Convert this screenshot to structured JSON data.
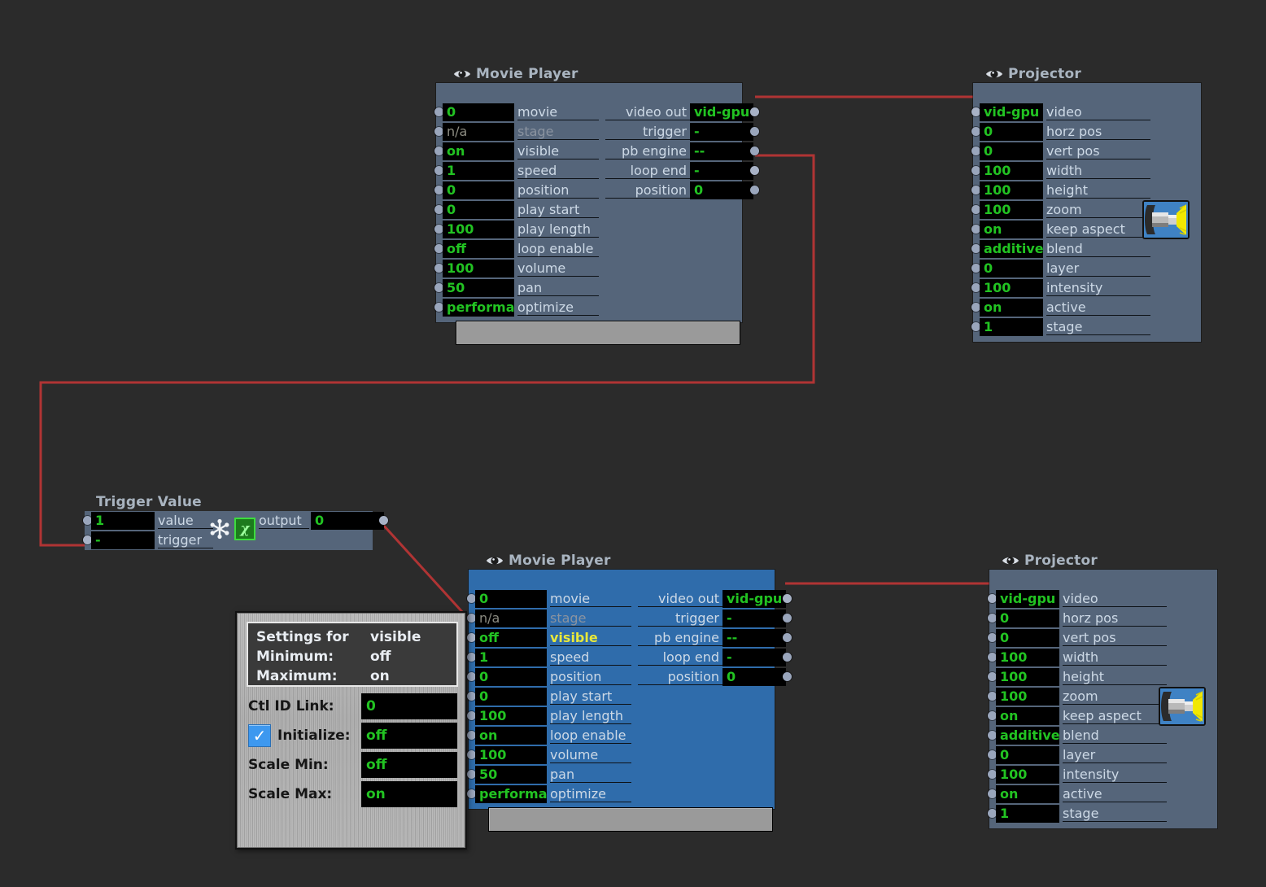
{
  "canvas": {
    "background": "#2b2b2b",
    "wire_color": "#b03434",
    "value_color": "#22c322",
    "selected_node_color": "#2f6cab"
  },
  "nodes": [
    {
      "id": "movie-player-1",
      "title": "Movie Player",
      "icon": "eye-icon",
      "selected": false,
      "inputs": [
        {
          "value": "0",
          "label": "movie"
        },
        {
          "value": "n/a",
          "label": "stage",
          "dim": true
        },
        {
          "value": "on",
          "label": "visible"
        },
        {
          "value": "1",
          "label": "speed"
        },
        {
          "value": "0",
          "label": "position"
        },
        {
          "value": "0",
          "label": "play start"
        },
        {
          "value": "100",
          "label": "play length"
        },
        {
          "value": "off",
          "label": "loop enable"
        },
        {
          "value": "100",
          "label": "volume"
        },
        {
          "value": "50",
          "label": "pan"
        },
        {
          "value": "performance",
          "label": "optimize"
        }
      ],
      "outputs": [
        {
          "label": "video out",
          "value": "vid-gpu",
          "connected": true
        },
        {
          "label": "trigger",
          "value": "-"
        },
        {
          "label": "pb engine",
          "value": "--"
        },
        {
          "label": "loop end",
          "value": "-",
          "connected": true
        },
        {
          "label": "position",
          "value": "0"
        }
      ],
      "has_scrubber": true
    },
    {
      "id": "projector-1",
      "title": "Projector",
      "icon": "eye-icon",
      "selected": false,
      "inputs": [
        {
          "value": "vid-gpu",
          "label": "video",
          "connected": true
        },
        {
          "value": "0",
          "label": "horz pos"
        },
        {
          "value": "0",
          "label": "vert pos"
        },
        {
          "value": "100",
          "label": "width"
        },
        {
          "value": "100",
          "label": "height"
        },
        {
          "value": "100",
          "label": "zoom"
        },
        {
          "value": "on",
          "label": "keep aspect"
        },
        {
          "value": "additive",
          "label": "blend"
        },
        {
          "value": "0",
          "label": "layer"
        },
        {
          "value": "100",
          "label": "intensity"
        },
        {
          "value": "on",
          "label": "active"
        },
        {
          "value": "1",
          "label": "stage"
        }
      ],
      "outputs": [],
      "lamp_icon": "projector-lamp-icon"
    },
    {
      "id": "trigger-value",
      "title": "Trigger Value",
      "icon": null,
      "selected": false,
      "inputs": [
        {
          "value": "1",
          "label": "value"
        },
        {
          "value": "-",
          "label": "trigger",
          "connected": true
        }
      ],
      "outputs": [
        {
          "label": "output",
          "value": "0",
          "connected": true
        }
      ],
      "icons": [
        "snowflake-icon",
        "curve-function-icon"
      ],
      "curve_glyph": "χ"
    },
    {
      "id": "movie-player-2",
      "title": "Movie Player",
      "icon": "eye-icon",
      "selected": true,
      "inputs": [
        {
          "value": "0",
          "label": "movie"
        },
        {
          "value": "n/a",
          "label": "stage",
          "dim": true
        },
        {
          "value": "off",
          "label": "visible",
          "highlight": true,
          "connected": true
        },
        {
          "value": "1",
          "label": "speed"
        },
        {
          "value": "0",
          "label": "position"
        },
        {
          "value": "0",
          "label": "play start"
        },
        {
          "value": "100",
          "label": "play length"
        },
        {
          "value": "on",
          "label": "loop enable"
        },
        {
          "value": "100",
          "label": "volume"
        },
        {
          "value": "50",
          "label": "pan"
        },
        {
          "value": "performance",
          "label": "optimize"
        }
      ],
      "outputs": [
        {
          "label": "video out",
          "value": "vid-gpu",
          "connected": true
        },
        {
          "label": "trigger",
          "value": "-"
        },
        {
          "label": "pb engine",
          "value": "--"
        },
        {
          "label": "loop end",
          "value": "-"
        },
        {
          "label": "position",
          "value": "0"
        }
      ],
      "has_scrubber": true
    },
    {
      "id": "projector-2",
      "title": "Projector",
      "icon": "eye-icon",
      "selected": false,
      "inputs": [
        {
          "value": "vid-gpu",
          "label": "video",
          "connected": true
        },
        {
          "value": "0",
          "label": "horz pos"
        },
        {
          "value": "0",
          "label": "vert pos"
        },
        {
          "value": "100",
          "label": "width"
        },
        {
          "value": "100",
          "label": "height"
        },
        {
          "value": "100",
          "label": "zoom"
        },
        {
          "value": "on",
          "label": "keep aspect"
        },
        {
          "value": "additive",
          "label": "blend"
        },
        {
          "value": "0",
          "label": "layer"
        },
        {
          "value": "100",
          "label": "intensity"
        },
        {
          "value": "on",
          "label": "active"
        },
        {
          "value": "1",
          "label": "stage"
        }
      ],
      "outputs": [],
      "lamp_icon": "projector-lamp-icon"
    }
  ],
  "dialog": {
    "header": {
      "title_key": "Settings for",
      "title_value": "visible",
      "minimum_key": "Minimum:",
      "minimum_value": "off",
      "maximum_key": "Maximum:",
      "maximum_value": "on"
    },
    "rows": [
      {
        "label": "Ctl ID Link:",
        "value": "0",
        "checkbox": false
      },
      {
        "label": "Initialize:",
        "value": "off",
        "checkbox": true,
        "checked": true,
        "check_glyph": "✓"
      },
      {
        "label": "Scale Min:",
        "value": "off",
        "checkbox": false
      },
      {
        "label": "Scale Max:",
        "value": "on",
        "checkbox": false
      }
    ]
  }
}
